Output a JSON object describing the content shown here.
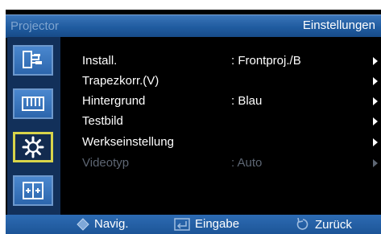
{
  "header": {
    "app_title": "Projector",
    "menu_title": "Einstellungen"
  },
  "sidebar": {
    "items": [
      {
        "icon": "input-source-icon",
        "active": false
      },
      {
        "icon": "picture-icon",
        "active": false
      },
      {
        "icon": "gear-icon",
        "active": true
      },
      {
        "icon": "screen-adjust-icon",
        "active": false
      }
    ]
  },
  "menu": {
    "rows": [
      {
        "label": "Install.",
        "value": ": Frontproj./B",
        "enabled": true
      },
      {
        "label": "Trapezkorr.(V)",
        "value": "",
        "enabled": true
      },
      {
        "label": "Hintergrund",
        "value": ": Blau",
        "enabled": true
      },
      {
        "label": "Testbild",
        "value": "",
        "enabled": true
      },
      {
        "label": "Werkseinstellung",
        "value": "",
        "enabled": true
      },
      {
        "label": "Videotyp",
        "value": ": Auto",
        "enabled": false
      }
    ]
  },
  "footer": {
    "navigate_label": "Navig.",
    "enter_label": "Eingabe",
    "back_label": "Zurück"
  },
  "colors": {
    "accent": "#2c66ad",
    "active_border": "#d8d44a",
    "disabled_text": "#5d6673"
  }
}
